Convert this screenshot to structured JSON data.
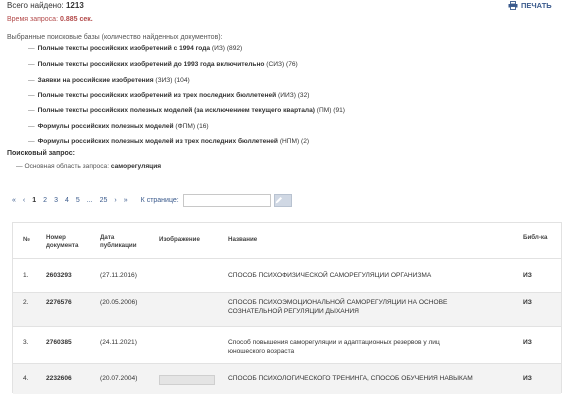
{
  "summary": {
    "total_label": "Всего найдено:",
    "total_value": "1213",
    "time_label": "Время запроса:",
    "time_value": "0.885 сек.",
    "print_label": "ПЕЧАТЬ"
  },
  "databases": {
    "header": "Выбранные поисковые базы (количество найденных документов):",
    "items": [
      {
        "name": "Полные тексты российских изобретений с 1994 года",
        "count": "(ИЗ) (892)"
      },
      {
        "name": "Полные тексты российских изобретений до 1993 года включительно",
        "count": "(СИЗ) (76)"
      },
      {
        "name": "Заявки на российские изобретения",
        "count": "(ЗИЗ) (104)"
      },
      {
        "name": "Полные тексты российских изобретений из трех последних бюллетеней",
        "count": "(ИИЗ) (32)"
      },
      {
        "name": "Полные тексты российских полезных моделей (за исключением текущего квартала)",
        "count": "(ПМ) (91)"
      },
      {
        "name": "Формулы российских полезных моделей",
        "count": "(ФПМ) (16)"
      },
      {
        "name": "Формулы российских полезных моделей из трех последних бюллетеней",
        "count": "(НПМ) (2)"
      }
    ]
  },
  "query": {
    "header": "Поисковый запрос:",
    "label": "Основная область запроса:",
    "value": "саморегуляция"
  },
  "pager": {
    "first": "«",
    "prev": "‹",
    "pages": [
      "1",
      "2",
      "3",
      "4",
      "5"
    ],
    "ellipsis": "...",
    "last_page": "25",
    "next": "›",
    "last": "»",
    "jump_label": "К странице:",
    "jump_value": ""
  },
  "table": {
    "headers": {
      "no": "№",
      "doc_number": "Номер документа",
      "pub_date": "Дата публикации",
      "image": "Изображение",
      "title": "Название",
      "library": "Библ-ка"
    },
    "rows": [
      {
        "no": "1.",
        "number": "2603293",
        "date": "(27.11.2016)",
        "title": "СПОСОБ ПСИХОФИЗИЧЕСКОЙ САМОРЕГУЛЯЦИИ ОРГАНИЗМА",
        "title2": "",
        "library": "ИЗ"
      },
      {
        "no": "2.",
        "number": "2276576",
        "date": "(20.05.2006)",
        "title": "СПОСОБ ПСИХОЭМОЦИОНАЛЬНОЙ САМОРЕГУЛЯЦИИ НА ОСНОВЕ",
        "title2": "СОЗНАТЕЛЬНОЙ РЕГУЛЯЦИИ ДЫХАНИЯ",
        "library": "ИЗ"
      },
      {
        "no": "3.",
        "number": "2760385",
        "date": "(24.11.2021)",
        "title": "Способ повышения саморегуляции и адаптационных резервов у лиц",
        "title2": "юношеского возраста",
        "library": "ИЗ"
      },
      {
        "no": "4.",
        "number": "2232606",
        "date": "(20.07.2004)",
        "title": "СПОСОБ ПСИХОЛОГИЧЕСКОГО ТРЕНИНГА, СПОСОБ ОБУЧЕНИЯ НАВЫКАМ",
        "title2": "",
        "library": "ИЗ"
      }
    ]
  }
}
